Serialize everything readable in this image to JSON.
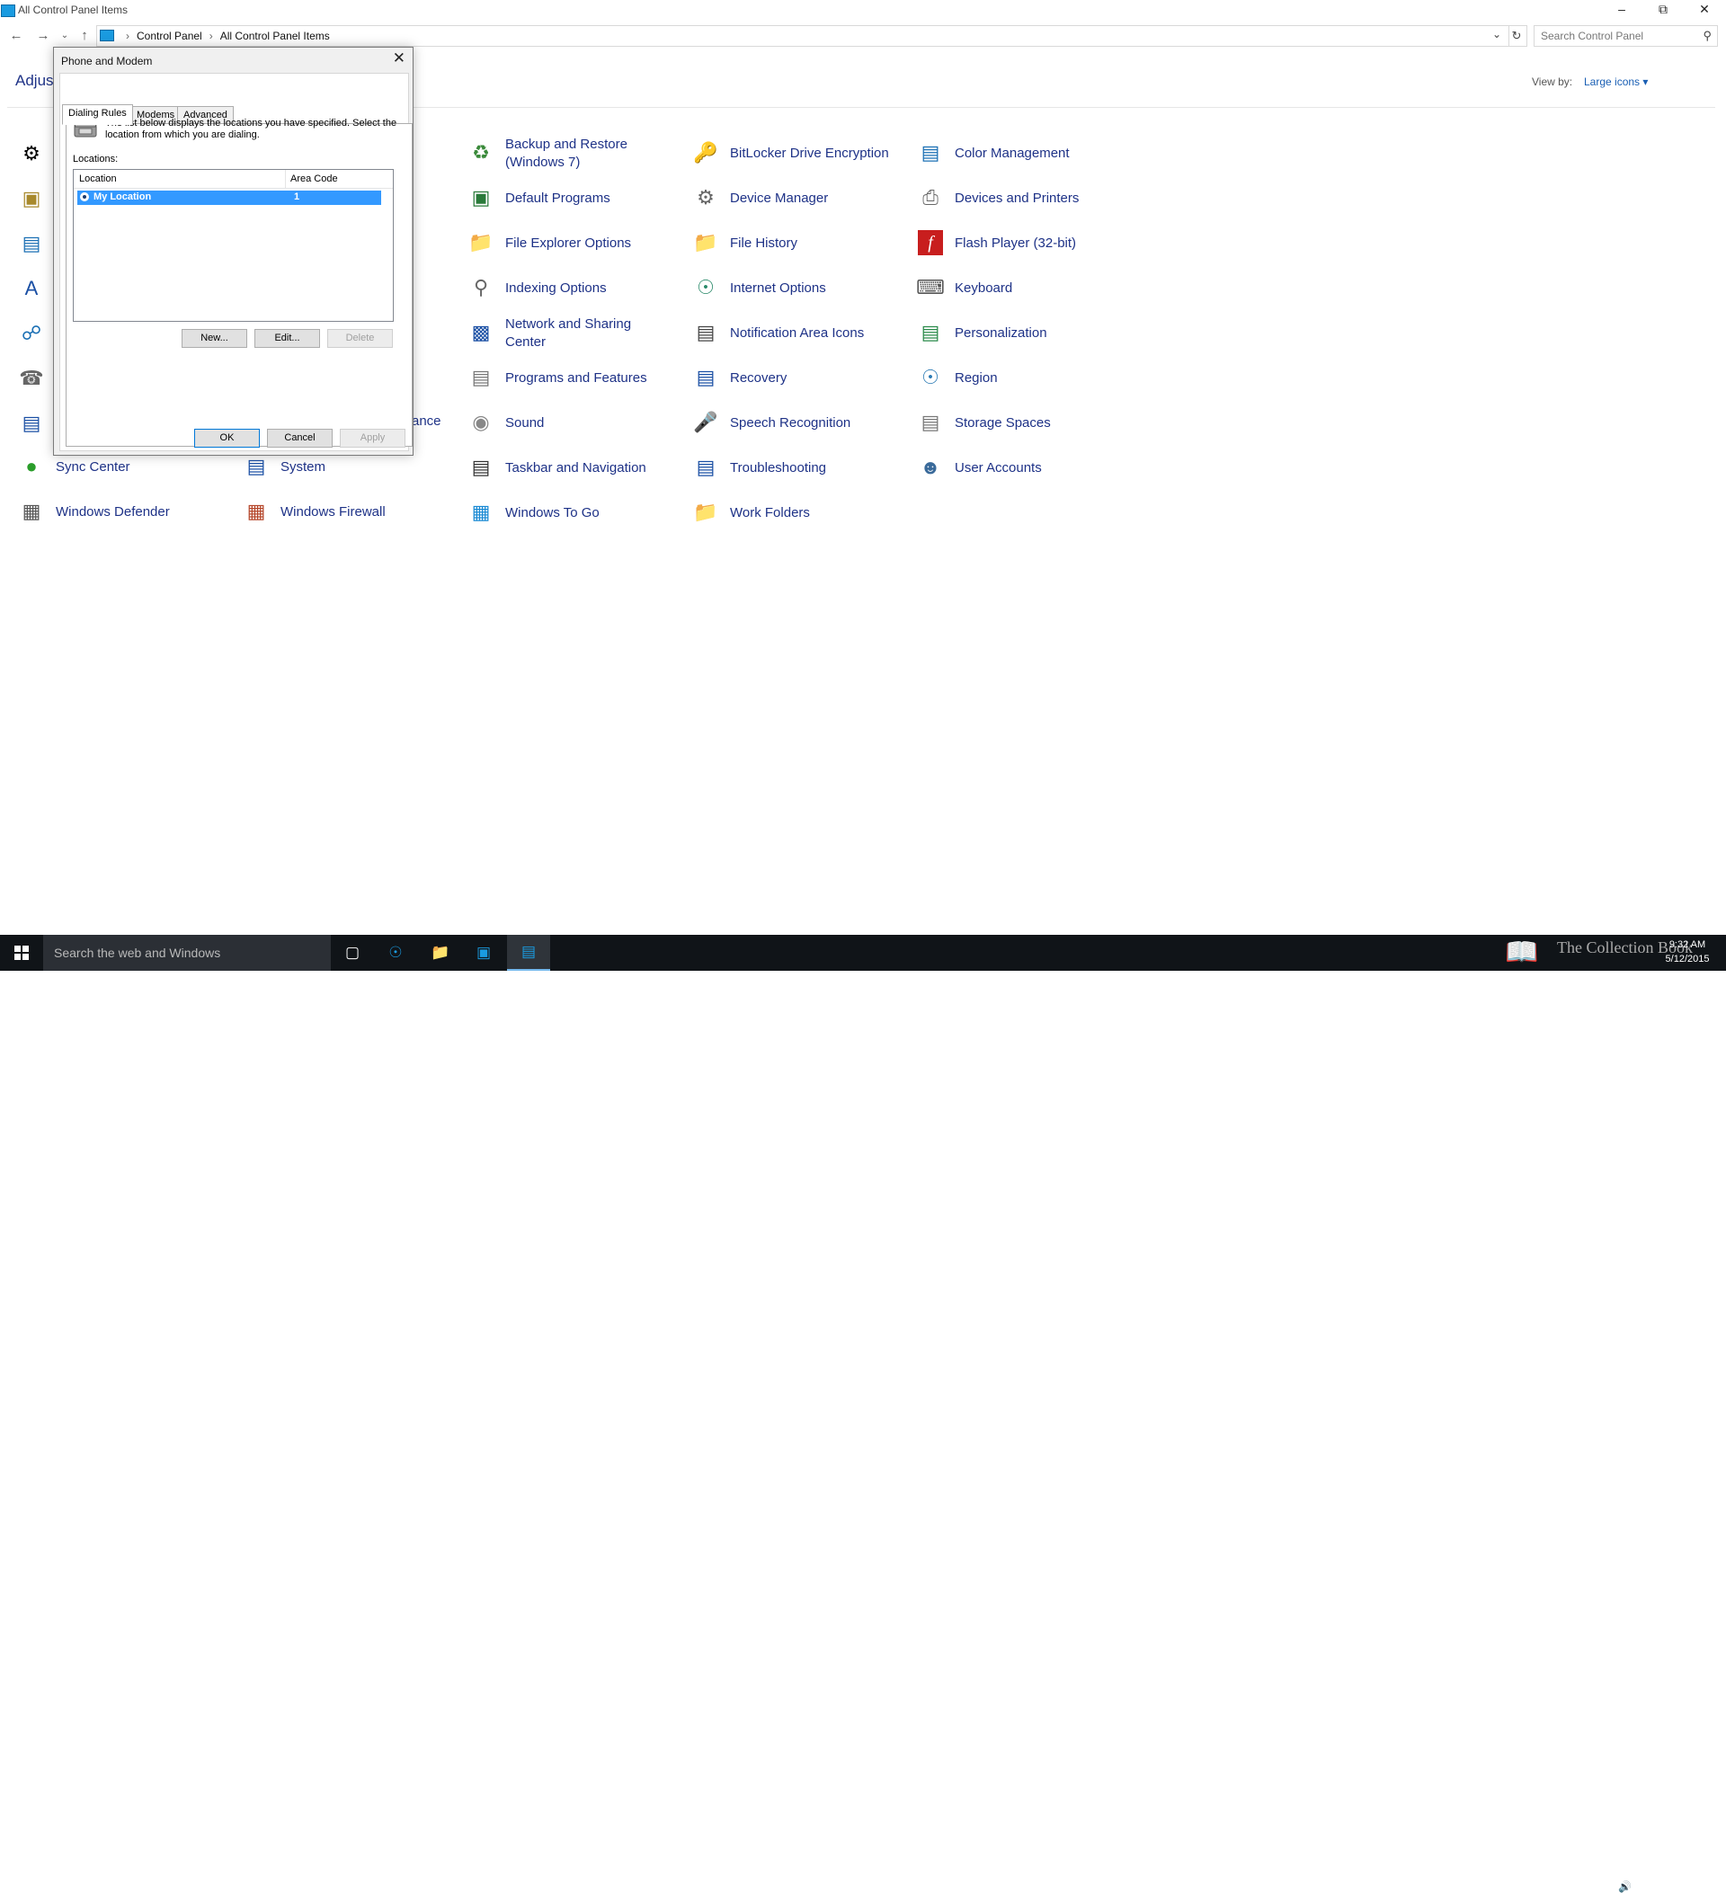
{
  "window": {
    "title": "All Control Panel Items"
  },
  "address": {
    "crumbs": [
      "Control Panel",
      "All Control Panel Items"
    ],
    "search_placeholder": "Search Control Panel"
  },
  "header": {
    "adjust_text": "Adjust",
    "view_by_label": "View by:",
    "view_by_value": "Large icons"
  },
  "items": {
    "col3": [
      {
        "label": "Backup and Restore\n(Windows 7)",
        "icon": "backup-restore-icon"
      },
      {
        "label": "Default Programs",
        "icon": "default-programs-icon"
      },
      {
        "label": "File Explorer Options",
        "icon": "folder-options-icon"
      },
      {
        "label": "Indexing Options",
        "icon": "indexing-icon"
      },
      {
        "label": "Network and Sharing\nCenter",
        "icon": "network-icon"
      },
      {
        "label": "Programs and Features",
        "icon": "programs-icon"
      },
      {
        "label": "Sound",
        "icon": "sound-icon"
      },
      {
        "label": "Taskbar and Navigation",
        "icon": "taskbar-icon"
      },
      {
        "label": "Windows To Go",
        "icon": "windows-to-go-icon"
      }
    ],
    "col4": [
      {
        "label": "BitLocker Drive Encryption",
        "icon": "bitlocker-icon"
      },
      {
        "label": "Device Manager",
        "icon": "device-manager-icon"
      },
      {
        "label": "File History",
        "icon": "file-history-icon"
      },
      {
        "label": "Internet Options",
        "icon": "internet-options-icon"
      },
      {
        "label": "Notification Area Icons",
        "icon": "notification-icon"
      },
      {
        "label": "Recovery",
        "icon": "recovery-icon"
      },
      {
        "label": "Speech Recognition",
        "icon": "microphone-icon"
      },
      {
        "label": "Troubleshooting",
        "icon": "troubleshooting-icon"
      },
      {
        "label": "Work Folders",
        "icon": "work-folders-icon"
      }
    ],
    "col5": [
      {
        "label": "Color Management",
        "icon": "color-management-icon"
      },
      {
        "label": "Devices and Printers",
        "icon": "printer-icon"
      },
      {
        "label": "Flash Player (32-bit)",
        "icon": "flash-icon"
      },
      {
        "label": "Keyboard",
        "icon": "keyboard-icon"
      },
      {
        "label": "Personalization",
        "icon": "personalization-icon"
      },
      {
        "label": "Region",
        "icon": "region-icon"
      },
      {
        "label": "Storage Spaces",
        "icon": "storage-icon"
      },
      {
        "label": "User Accounts",
        "icon": "user-accounts-icon"
      }
    ],
    "col1_bottom": [
      {
        "label": "Sync Center",
        "icon": "sync-icon"
      },
      {
        "label": "Windows Defender",
        "icon": "defender-icon"
      }
    ],
    "col2_bottom": [
      {
        "label": "System",
        "icon": "system-icon"
      },
      {
        "label": "Windows Firewall",
        "icon": "firewall-icon"
      }
    ],
    "col2_fragment": "ance"
  },
  "dialog": {
    "title": "Phone and Modem",
    "tabs": [
      "Dialing Rules",
      "Modems",
      "Advanced"
    ],
    "description": "The list below displays the locations you have specified. Select the location from which you are dialing.",
    "locations_label": "Locations:",
    "columns": [
      "Location",
      "Area Code"
    ],
    "rows": [
      {
        "location": "My Location",
        "area_code": "1"
      }
    ],
    "buttons": {
      "new": "New...",
      "edit": "Edit...",
      "delete": "Delete",
      "ok": "OK",
      "cancel": "Cancel",
      "apply": "Apply"
    }
  },
  "taskbar": {
    "search_placeholder": "Search the web and Windows",
    "time": "9:32 AM",
    "date": "5/12/2015",
    "watermark": "The Collection Book"
  }
}
